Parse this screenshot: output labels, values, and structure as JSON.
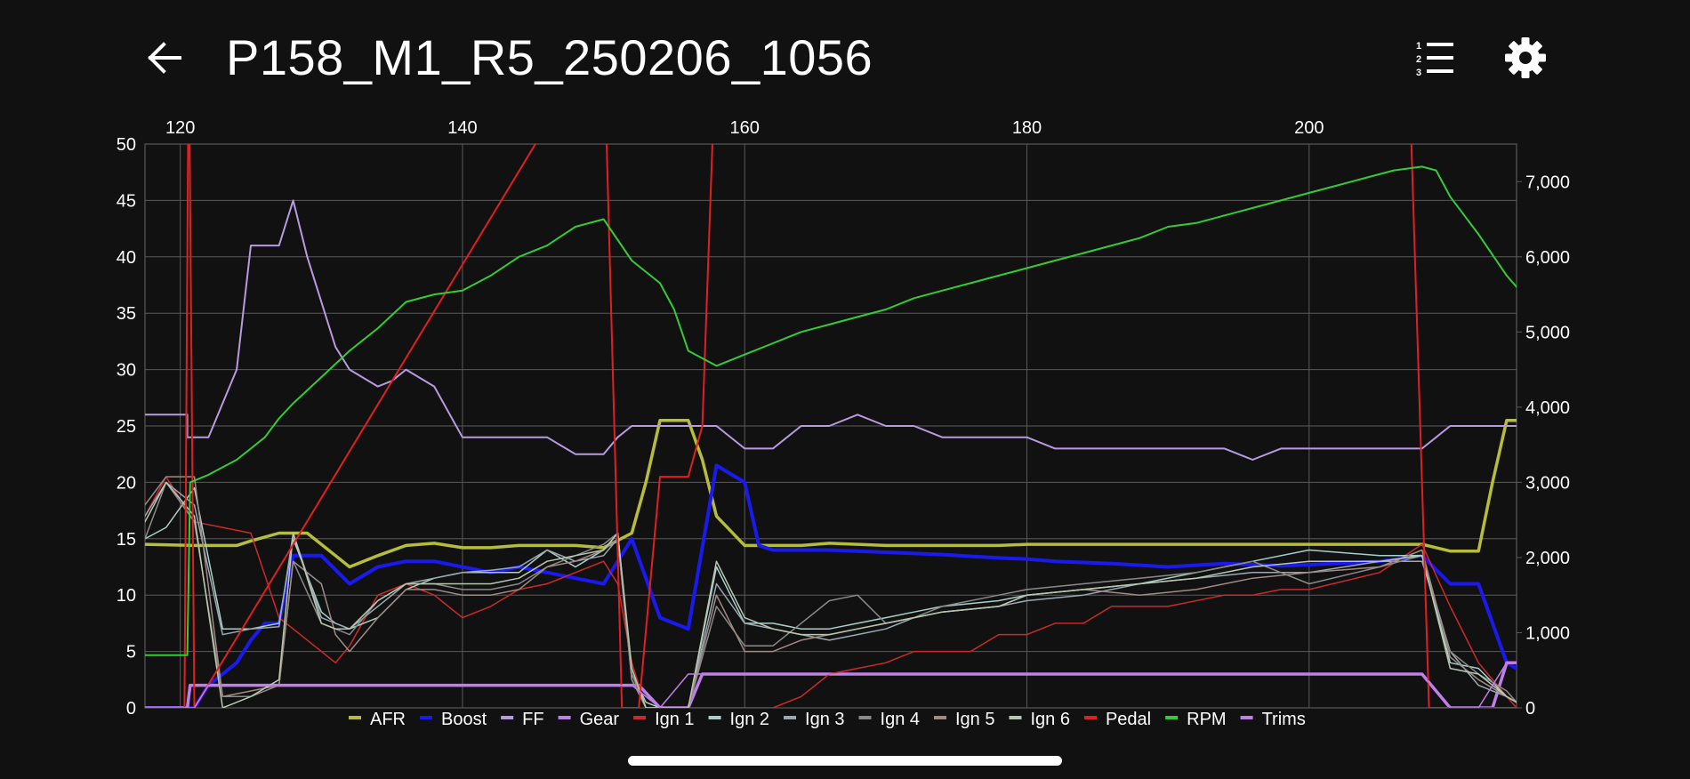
{
  "header": {
    "title": "P158_M1_R5_250206_1056"
  },
  "icons": {
    "back": "arrow-left-icon",
    "list": "numbered-list-icon",
    "settings": "gear-icon"
  },
  "colors": {
    "background": "#111111",
    "grid": "#5a5a5a",
    "text": "#ffffff"
  },
  "chart_data": {
    "type": "line",
    "x_ticks": [
      120,
      140,
      160,
      180,
      200
    ],
    "xlim": [
      117.5,
      214.7
    ],
    "ylim_left": [
      0,
      50
    ],
    "y_ticks_left": [
      0,
      5,
      10,
      15,
      20,
      25,
      30,
      35,
      40,
      45,
      50
    ],
    "ylim_right": [
      0,
      7500
    ],
    "y_ticks_right": [
      "0",
      "1,000",
      "2,000",
      "3,000",
      "4,000",
      "5,000",
      "6,000",
      "7,000"
    ],
    "grid": true,
    "legend_placement": "bottom",
    "series": [
      {
        "name": "AFR",
        "color": "#b5bd3a",
        "width": 3.5,
        "axis": "left",
        "x": [
          117.5,
          121,
          122,
          124,
          125,
          127,
          129,
          130,
          132,
          134,
          136,
          138,
          140,
          142,
          144,
          146,
          148,
          150,
          152,
          153,
          154,
          156,
          157,
          158,
          160,
          161,
          164,
          166,
          170,
          174,
          178,
          180,
          182,
          190,
          196,
          200,
          205,
          208,
          210,
          212,
          213,
          214,
          214.7
        ],
        "y": [
          14.5,
          14.4,
          14.4,
          14.4,
          14.8,
          15.5,
          15.5,
          14.5,
          12.5,
          13.5,
          14.4,
          14.6,
          14.2,
          14.2,
          14.4,
          14.4,
          14.4,
          14.2,
          15.5,
          20,
          25.5,
          25.5,
          22,
          17,
          14.4,
          14.4,
          14.4,
          14.6,
          14.4,
          14.4,
          14.4,
          14.5,
          14.5,
          14.5,
          14.5,
          14.5,
          14.5,
          14.5,
          13.9,
          13.9,
          20,
          25.5,
          25.5
        ]
      },
      {
        "name": "Boost",
        "color": "#1a1aee",
        "width": 4,
        "axis": "left",
        "x": [
          117.5,
          121,
          122,
          124,
          125,
          126,
          127,
          128,
          130,
          132,
          134,
          136,
          138,
          140,
          142,
          144,
          146,
          148,
          150,
          151,
          152,
          154,
          156,
          158,
          160,
          161,
          162,
          164,
          166,
          170,
          174,
          178,
          180,
          182,
          186,
          190,
          194,
          198,
          200,
          205,
          208,
          210,
          212,
          214,
          214.7
        ],
        "y": [
          0,
          0,
          2,
          4,
          6,
          7.5,
          7.5,
          13.5,
          13.5,
          11,
          12.5,
          13,
          13,
          12.5,
          12,
          12.5,
          12,
          11.5,
          11,
          13,
          15,
          8,
          7,
          21.5,
          20,
          14.4,
          14,
          14,
          14,
          13.8,
          13.6,
          13.3,
          13.2,
          13,
          12.8,
          12.5,
          12.8,
          12.6,
          12.7,
          13,
          13.5,
          11,
          11,
          4,
          3.5
        ]
      },
      {
        "name": "FF",
        "color": "#b89ae0",
        "width": 2,
        "axis": "left",
        "x": [
          117.5,
          120.5,
          120.5,
          122,
          124,
          125,
          126,
          127,
          128,
          129,
          131,
          132,
          134,
          135,
          136,
          138,
          140,
          142,
          144,
          146,
          148,
          150,
          151,
          152,
          153,
          154,
          156,
          158,
          160,
          162,
          164,
          166,
          168,
          170,
          172,
          174,
          178,
          180,
          182,
          186,
          190,
          194,
          196,
          198,
          200,
          205,
          208,
          209,
          210,
          212,
          214,
          214.7
        ],
        "y": [
          26,
          26,
          24,
          24,
          30,
          41,
          41,
          41,
          45,
          40,
          32,
          30,
          28.5,
          29,
          30,
          28.5,
          24,
          24,
          24,
          24,
          22.5,
          22.5,
          24,
          25,
          25,
          25,
          25,
          25,
          23,
          23,
          25,
          25,
          26,
          25,
          25,
          24,
          24,
          24,
          23,
          23,
          23,
          23,
          22,
          23,
          23,
          23,
          23,
          24,
          25,
          25,
          25,
          25
        ]
      },
      {
        "name": "Gear",
        "color": "#c07ee8",
        "width": 3.5,
        "axis": "left",
        "x": [
          117.5,
          120.5,
          120.7,
          150,
          151,
          152,
          152.5,
          154,
          155,
          156,
          157,
          159,
          160,
          170,
          180,
          190,
          200,
          207,
          208,
          210,
          211,
          213,
          214,
          214.7
        ],
        "y": [
          0,
          0,
          2,
          2,
          2,
          2,
          2,
          0,
          0,
          0,
          3,
          3,
          3,
          3,
          3,
          3,
          3,
          3,
          3,
          0,
          0,
          0,
          4,
          4
        ]
      },
      {
        "name": "Ign 1",
        "color": "#cc2a2a",
        "width": 1.5,
        "axis": "left",
        "x": [
          117.5,
          119,
          121,
          123,
          125,
          127,
          128,
          130,
          131,
          132,
          134,
          136,
          138,
          140,
          142,
          144,
          146,
          148,
          150,
          151,
          152,
          153,
          154,
          156,
          158,
          160,
          162,
          164,
          166,
          168,
          170,
          172,
          174,
          176,
          178,
          180,
          182,
          184,
          186,
          190,
          194,
          196,
          198,
          200,
          205,
          208,
          210,
          212,
          214,
          214.7
        ],
        "y": [
          17,
          20.5,
          16.5,
          16,
          15.5,
          8,
          7,
          5,
          4,
          5.5,
          10,
          11,
          10,
          8,
          9,
          10.5,
          11,
          12,
          13,
          11,
          4,
          0,
          0,
          0,
          0,
          0,
          0,
          1,
          3,
          3.5,
          4,
          5,
          5,
          5,
          6.5,
          6.5,
          7.5,
          7.5,
          9,
          9,
          10,
          10,
          10.5,
          10.5,
          12,
          14.5,
          9,
          4,
          1,
          0
        ]
      },
      {
        "name": "Ign 2",
        "color": "#a8d0c8",
        "width": 1.5,
        "axis": "left",
        "x": [
          117.5,
          119,
          121,
          123,
          125,
          127,
          128,
          130,
          131,
          132,
          134,
          136,
          138,
          140,
          142,
          144,
          146,
          148,
          150,
          151,
          152,
          153,
          154,
          156,
          158,
          160,
          162,
          164,
          166,
          168,
          170,
          172,
          174,
          178,
          180,
          184,
          188,
          192,
          196,
          200,
          205,
          208,
          210,
          212,
          214,
          214.7
        ],
        "y": [
          15,
          16,
          19.5,
          7,
          7,
          7.5,
          15,
          8.5,
          7.5,
          7,
          8,
          10.5,
          11.5,
          12,
          12,
          12,
          14,
          12.5,
          14,
          15.5,
          3,
          0.5,
          0,
          0,
          12.5,
          7.5,
          7.5,
          7,
          7,
          7.5,
          8,
          8.5,
          9,
          9.5,
          10,
          10.5,
          11,
          12,
          13,
          14,
          13.5,
          13.5,
          4,
          3.5,
          1,
          0.5
        ]
      },
      {
        "name": "Ign 3",
        "color": "#9aa9b4",
        "width": 1.5,
        "axis": "left",
        "x": [
          117.5,
          119,
          121,
          123,
          125,
          127,
          128,
          130,
          131,
          132,
          134,
          136,
          138,
          140,
          142,
          144,
          146,
          148,
          150,
          151,
          152,
          153,
          154,
          156,
          158,
          160,
          162,
          164,
          166,
          168,
          170,
          172,
          174,
          178,
          180,
          184,
          188,
          192,
          196,
          200,
          205,
          208,
          210,
          212,
          214,
          214.7
        ],
        "y": [
          17,
          20,
          18,
          6.5,
          7,
          7.2,
          15.5,
          8,
          7.5,
          7,
          9,
          11,
          11.5,
          12,
          12.2,
          12.5,
          14,
          13,
          13.5,
          15,
          2.5,
          0,
          0,
          0,
          11,
          7.5,
          7,
          6.5,
          6,
          6.5,
          7,
          8,
          8.5,
          9,
          9.5,
          10,
          11,
          11.5,
          12,
          12,
          13,
          13,
          5,
          2,
          1,
          0.5
        ]
      },
      {
        "name": "Ign 4",
        "color": "#8a8a8a",
        "width": 1.5,
        "axis": "left",
        "x": [
          117.5,
          119,
          121,
          123,
          125,
          127,
          128,
          130,
          131,
          132,
          134,
          136,
          138,
          140,
          142,
          144,
          146,
          148,
          150,
          151,
          152,
          153,
          154,
          156,
          158,
          160,
          162,
          164,
          166,
          168,
          170,
          172,
          174,
          178,
          180,
          184,
          188,
          192,
          196,
          200,
          205,
          208,
          210,
          212,
          214,
          214.7
        ],
        "y": [
          15,
          20,
          16.5,
          1,
          1,
          2,
          13,
          7.5,
          7,
          6.5,
          9.5,
          11,
          11,
          10.5,
          10.5,
          11,
          12.5,
          13.5,
          14.5,
          15.5,
          3,
          0,
          0,
          0,
          9,
          5.5,
          5.5,
          7.5,
          9.5,
          10,
          7.5,
          8,
          9,
          10,
          10.5,
          11,
          11.5,
          12,
          13,
          11,
          12.5,
          13.5,
          5,
          3,
          1.5,
          0.5
        ]
      },
      {
        "name": "Ign 5",
        "color": "#a08a86",
        "width": 1.5,
        "axis": "left",
        "x": [
          117.5,
          119,
          121,
          123,
          125,
          127,
          128,
          130,
          131,
          132,
          134,
          136,
          138,
          140,
          142,
          144,
          146,
          148,
          150,
          151,
          152,
          153,
          154,
          156,
          158,
          160,
          162,
          164,
          166,
          168,
          170,
          172,
          174,
          178,
          180,
          184,
          188,
          192,
          196,
          200,
          205,
          208,
          210,
          212,
          214,
          214.7
        ],
        "y": [
          18,
          20.5,
          20.5,
          1,
          1.5,
          2,
          13,
          11,
          6.5,
          5,
          8,
          10.5,
          10.5,
          10,
          10,
          10.5,
          12.5,
          13,
          14,
          15,
          2.5,
          0,
          0,
          0,
          10,
          5,
          5,
          6,
          6.5,
          7,
          7.5,
          8,
          8.5,
          9,
          10,
          10.5,
          10,
          10.5,
          11.5,
          12,
          12.5,
          14,
          4.5,
          2.5,
          1,
          0.5
        ]
      },
      {
        "name": "Ign 6",
        "color": "#b8c8b0",
        "width": 1.5,
        "axis": "left",
        "x": [
          117.5,
          119,
          121,
          123,
          125,
          127,
          128,
          130,
          131,
          132,
          134,
          136,
          138,
          140,
          142,
          144,
          146,
          148,
          150,
          151,
          152,
          153,
          154,
          156,
          158,
          160,
          162,
          164,
          166,
          168,
          170,
          172,
          174,
          178,
          180,
          184,
          188,
          192,
          196,
          200,
          205,
          208,
          210,
          212,
          214,
          214.7
        ],
        "y": [
          16.5,
          20,
          17,
          0,
          1,
          2.5,
          15.5,
          7.5,
          7,
          7,
          9.5,
          11,
          11,
          11,
          11,
          11.5,
          13,
          13.5,
          14,
          15.5,
          3.5,
          0,
          0,
          0,
          13,
          8,
          7,
          6.5,
          6.5,
          7,
          7.5,
          8,
          8.5,
          9,
          10,
          10.5,
          11,
          11.5,
          12.5,
          13,
          13,
          13.5,
          3.5,
          3,
          1,
          0.5
        ]
      },
      {
        "name": "Pedal",
        "color": "#e02020",
        "width": 2,
        "axis": "left",
        "x": [
          117.5,
          120.3,
          120.6,
          121,
          150,
          151.3,
          152.5,
          154,
          156,
          157,
          158,
          160,
          170,
          190,
          207,
          208.5,
          214.7
        ],
        "y": [
          0,
          0,
          60,
          0,
          60,
          0,
          0,
          20.5,
          20.5,
          25,
          60,
          60,
          60,
          60,
          60,
          0,
          0
        ]
      },
      {
        "name": "RPM",
        "color": "#33cc33",
        "width": 2,
        "axis": "right",
        "x": [
          117.5,
          120.5,
          120.7,
          122,
          124,
          125,
          126,
          127,
          128,
          130,
          132,
          134,
          136,
          138,
          140,
          142,
          144,
          146,
          148,
          150,
          152,
          154,
          155,
          156,
          158,
          160,
          162,
          164,
          166,
          168,
          170,
          172,
          174,
          176,
          178,
          180,
          182,
          184,
          186,
          188,
          190,
          192,
          194,
          196,
          198,
          200,
          202,
          204,
          206,
          208,
          209,
          210,
          212,
          214,
          214.7
        ],
        "y": [
          700,
          700,
          3000,
          3100,
          3300,
          3450,
          3600,
          3850,
          4050,
          4400,
          4750,
          5050,
          5400,
          5500,
          5550,
          5750,
          6000,
          6150,
          6400,
          6500,
          5950,
          5650,
          5300,
          4750,
          4550,
          4700,
          4850,
          5000,
          5100,
          5200,
          5300,
          5450,
          5550,
          5650,
          5750,
          5850,
          5950,
          6050,
          6150,
          6250,
          6400,
          6450,
          6550,
          6650,
          6750,
          6850,
          6950,
          7050,
          7150,
          7200,
          7150,
          6800,
          6300,
          5750,
          5600
        ]
      },
      {
        "name": "Trims",
        "color": "#c07ee8",
        "width": 1.5,
        "axis": "left",
        "x": [
          117.5,
          121,
          122,
          130,
          140,
          150,
          152,
          154,
          156,
          160,
          170,
          180,
          190,
          200,
          207,
          208,
          210,
          212,
          214,
          214.7
        ],
        "y": [
          0,
          0,
          2,
          2,
          2,
          2,
          2,
          0,
          3,
          3,
          3,
          3,
          3,
          3,
          3,
          3,
          0,
          0,
          4,
          4
        ]
      }
    ]
  }
}
